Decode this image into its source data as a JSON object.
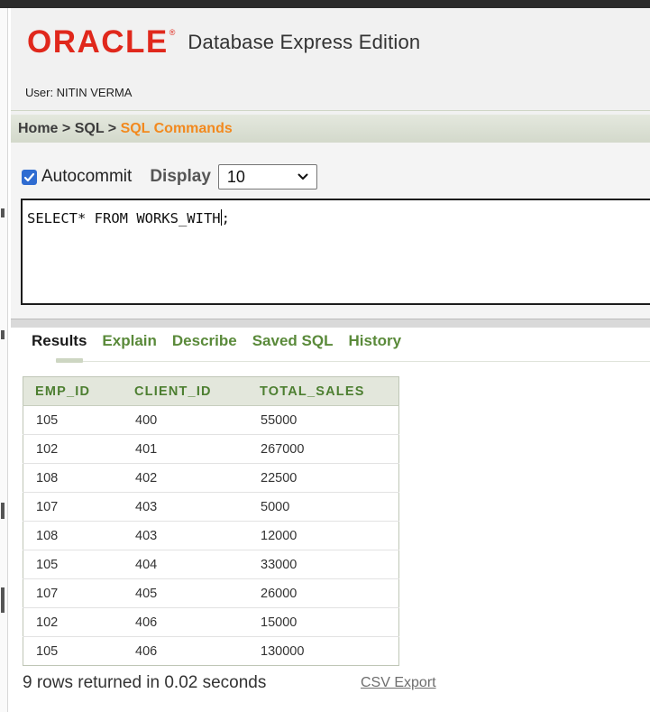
{
  "header": {
    "brand": "ORACLE",
    "brand_mark": "®",
    "product": "Database Express Edition",
    "user": "User: NITIN VERMA"
  },
  "breadcrumb": {
    "home": "Home",
    "sql": "SQL",
    "current": "SQL Commands",
    "separator": ">"
  },
  "toolbar": {
    "autocommit_label": "Autocommit",
    "autocommit_checked": true,
    "display_label": "Display",
    "display_value": "10"
  },
  "editor": {
    "sql": "SELECT* FROM WORKS_WITH;"
  },
  "tabs": [
    "Results",
    "Explain",
    "Describe",
    "Saved SQL",
    "History"
  ],
  "results": {
    "columns": [
      "EMP_ID",
      "CLIENT_ID",
      "TOTAL_SALES"
    ],
    "rows": [
      [
        "105",
        "400",
        "55000"
      ],
      [
        "102",
        "401",
        "267000"
      ],
      [
        "108",
        "402",
        "22500"
      ],
      [
        "107",
        "403",
        "5000"
      ],
      [
        "108",
        "403",
        "12000"
      ],
      [
        "105",
        "404",
        "33000"
      ],
      [
        "107",
        "405",
        "26000"
      ],
      [
        "102",
        "406",
        "15000"
      ],
      [
        "105",
        "406",
        "130000"
      ]
    ]
  },
  "footer": {
    "summary": "9 rows returned in 0.02 seconds",
    "csv_export": "CSV Export"
  },
  "colors": {
    "brand_red": "#e0281c",
    "breadcrumb_current": "#f2891e",
    "tab_green": "#5a8a3a",
    "header_green": "#4d7f31",
    "checkbox_blue": "#2f6cd1"
  }
}
